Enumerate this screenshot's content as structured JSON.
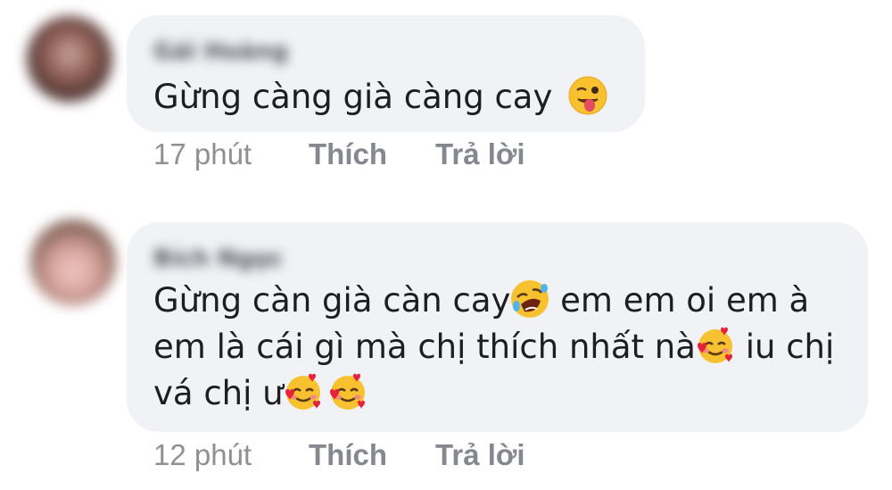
{
  "comments": [
    {
      "author": "Gái Hoàng",
      "text_lines": [
        "Gừng càng già càng cay"
      ],
      "emojis": [
        "winking-tongue-face"
      ],
      "time": "17 phút",
      "like_label": "Thích",
      "reply_label": "Trả lời"
    },
    {
      "author": "Bích Ngọc",
      "text_lines": [
        "Gừng càn già càn cay",
        " em em oi em à",
        "em là cái gì mà chị thích nhất nà",
        " iu chị",
        "vá chị ư"
      ],
      "emojis": [
        "rolling-on-floor-laughing-face",
        "smiling-face-with-hearts",
        "smiling-face-with-hearts",
        "smiling-face-with-hearts"
      ],
      "time": "12 phút",
      "like_label": "Thích",
      "reply_label": "Trả lời"
    }
  ],
  "colors": {
    "bubble": "#f0f2f5",
    "text": "#1c1e21",
    "meta": "#8e9096"
  }
}
